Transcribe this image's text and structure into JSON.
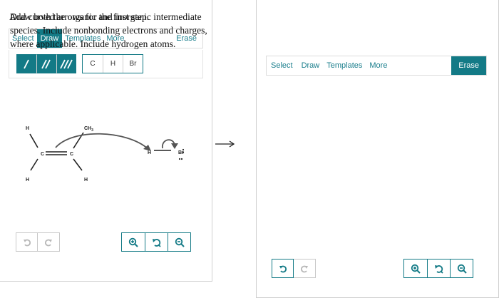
{
  "left": {
    "prompt": "Add curved arrows for the first step.",
    "toolbar": {
      "select": "Select",
      "draw": "Draw",
      "templates": "Templates",
      "more": "More",
      "erase": "Erase"
    },
    "atoms": [
      "C",
      "H",
      "Br"
    ],
    "molecule_labels": {
      "h_top": "H",
      "ch3": "CH",
      "ch3_sub": "3",
      "c_left": "C",
      "c_right": "C",
      "h_bottom_left": "H",
      "h_bottom_right": "H",
      "hbr_h": "H",
      "hbr_br": "Br"
    }
  },
  "right": {
    "prompt": "Draw both the organic and inorganic intermediate species. Include nonbonding electrons and charges, where applicable. Include hydrogen atoms.",
    "toolbar": {
      "select": "Select",
      "draw": "Draw",
      "templates": "Templates",
      "more": "More",
      "erase": "Erase"
    }
  },
  "reaction_arrow": "→",
  "colors": {
    "accent": "#137a86",
    "border": "#cfcfcf",
    "disabled": "#b8b8b8",
    "molecule": "#222222",
    "arrow": "#555555"
  }
}
